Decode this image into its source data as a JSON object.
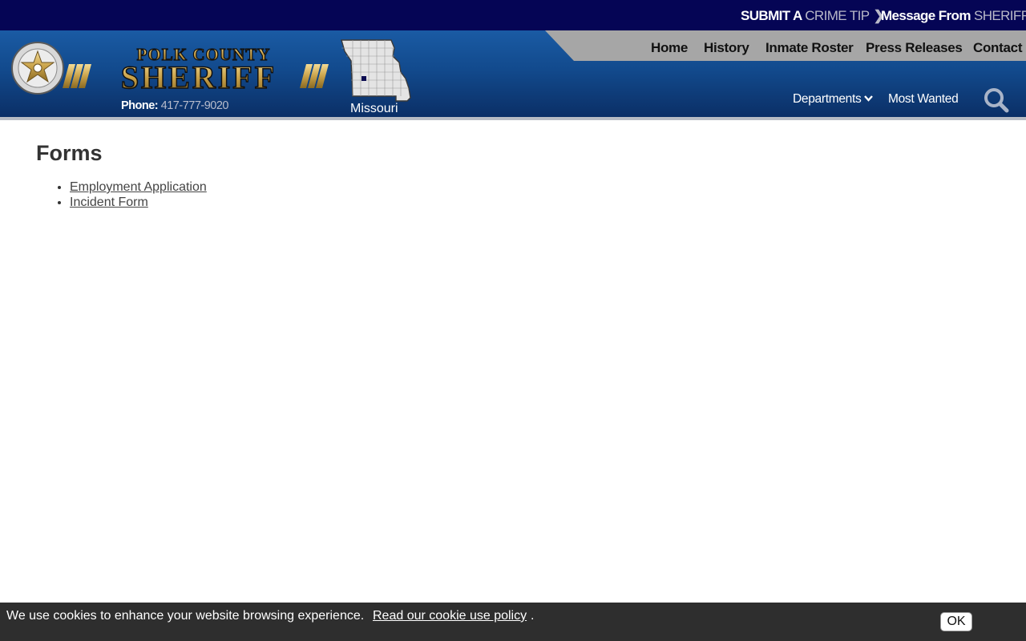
{
  "topbar": {
    "crime_tip_prefix": "SUBMIT A",
    "crime_tip_highlight": "CRIME TIP",
    "sheriff_prefix": "Message From",
    "sheriff_highlight": "SHERIFF"
  },
  "header": {
    "logo_title_top": "POLK COUNTY",
    "logo_title_main": "SHERIFF",
    "phone_label": "Phone:",
    "phone_number": "417-777-9020",
    "map_label": "Missouri"
  },
  "nav": {
    "main": [
      "Home",
      "History",
      "Inmate Roster",
      "Press Releases",
      "Contact"
    ],
    "sub": [
      "Departments",
      "Most Wanted"
    ]
  },
  "content": {
    "title": "Forms",
    "links": [
      "Employment Application",
      "Incident Form"
    ]
  },
  "cookie_bar": {
    "text": "We use cookies to enhance your website browsing experience.",
    "policy_link": "Read our cookie use policy",
    "trailing": ".",
    "ok_label": "OK"
  },
  "colors": {
    "topbar": "#050555",
    "header": "#124a8d",
    "nav_band": "#a6a6a6",
    "cookie_bar": "#2e2e2e"
  },
  "icons": [
    "chevron-right-icon",
    "chevron-down-icon",
    "search-icon",
    "sheriff-badge-icon",
    "missouri-map-icon"
  ]
}
